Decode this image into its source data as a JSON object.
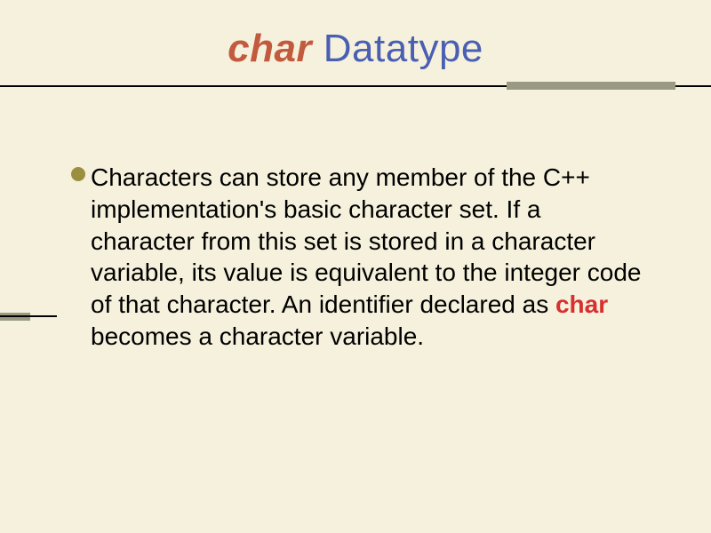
{
  "title": {
    "char_word": "char",
    "datatype_word": " Datatype"
  },
  "bullet": {
    "part1": "Characters can store any member of the C++ implementation's basic character set. If a character from this set is stored in a character variable, its value is equivalent to the integer code of that character. An identifier declared as ",
    "char_word": "char",
    "part2": " becomes a character variable."
  }
}
